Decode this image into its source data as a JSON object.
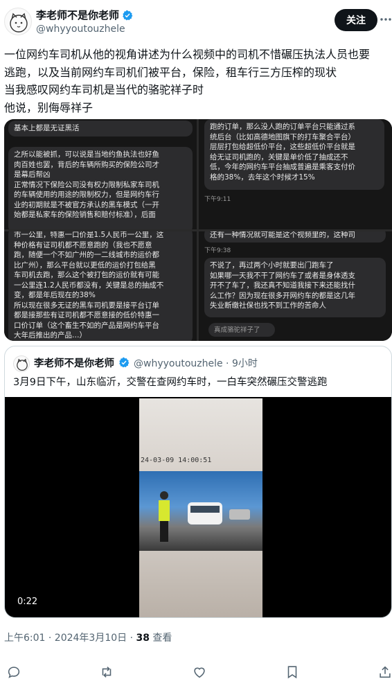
{
  "author": {
    "name": "李老师不是你老师",
    "handle": "@whyyoutouzhele",
    "follow_label": "关注"
  },
  "tweet": {
    "lines": [
      "一位网约车司机从他的视角讲述为什么视频中的司机不惜碾压执法人员也要",
      "逃跑，以及当前网约车司机们被平台，保险，租车行三方压榨的现状",
      "当我感叹网约车司机是当代的骆驼祥子时",
      "他说，别侮辱祥子"
    ]
  },
  "images": {
    "top_left": {
      "header_line": "基本上都是无证黑活",
      "body": [
        "之所以能被抓，可以说是当地约鱼执法也好鱼",
        "肉百姓也罢，背后的车辆所购买的保险公司才",
        "是幕后帮凶",
        "正常情况下保险公司没有权力限制私家车司机",
        "的车辆使用的用途的限制权力，但是网约车行",
        "业的初期就是不被官方承认的黑车模式（一开",
        "始都是私家车的保险销售和赔付标准），后面"
      ]
    },
    "top_right": {
      "body": [
        "跑的订单，那么没人跑的订单平台只能通过系",
        "统后台（比如高德地图旗下的打车聚合平台）",
        "层层打包给超低价平台，这些超低价平台就是",
        "给无证司机跑的，关键是单价低了抽成还不",
        "低，今年的网约车平台抽成普遍是乘客支付价",
        "格的38%，去年这个时候才15%"
      ],
      "time": "下午9:11"
    },
    "bottom_left": {
      "body": [
        "市一公里，特惠一口价是1.5人民币一公里，这",
        "种价格有证司机都不愿意跑的（我也不愿意",
        "跑，随便一个不如广州的一二线城市的运价都",
        "比广州），那么平台就以更低的运价打包给黑",
        "车司机去跑，那么这个被打包的运价就有可能",
        "一公里连1.2人民币都没有，关键是总的抽成不",
        "变，都是年后现在的38%",
        "所以现在很多无证的黑车司机要是接平台订单",
        "都是接那些有证司机都不愿意接的低价特惠一",
        "口价订单（这个畜生不如的产品是网约车平台",
        "大年后推出的产品…）"
      ]
    },
    "bottom_right": {
      "top_line": "还有一种情况就可能是这个视频里的，这种司",
      "time": "下午9:38",
      "body": [
        "不说了，再过两个小时就要出门跑车了",
        "如果哪一天我不干了网约车了或者是身体透支",
        "开不了车了，我还真不知道我接下来还能找什",
        "么工作？因为现在很多开网约车的都是这几年",
        "失业断缴社保也找不到工作的苦命人"
      ],
      "reply": "真成骆驼祥子了"
    }
  },
  "quote": {
    "name": "李老师不是你老师",
    "handle_time": "@whyyoutouzhele · 9小时",
    "text": "3月9日下午，山东临沂，交警在查网约车时，一白车突然碾压交警逃跑",
    "video_timestamp": "24-03-09 14:00:51",
    "video_duration": "0:22"
  },
  "meta": {
    "time_date": "上午6:01 · 2024年3月10日 · ",
    "views_count": "38",
    "views_label": " 查看"
  },
  "colors": {
    "accent": "#1d9bf0",
    "text_primary": "#0f1419",
    "text_secondary": "#536471"
  },
  "icons": [
    "verified-badge-icon",
    "more-icon",
    "reply-icon",
    "retweet-icon",
    "like-icon",
    "bookmark-icon",
    "share-icon"
  ]
}
